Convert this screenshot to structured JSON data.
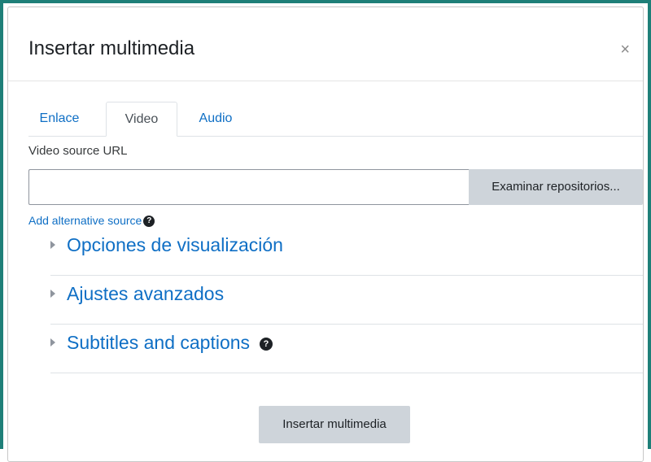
{
  "dialog": {
    "title": "Insertar multimedia",
    "close_label": "×"
  },
  "tabs": [
    {
      "label": "Enlace",
      "active": false
    },
    {
      "label": "Video",
      "active": true
    },
    {
      "label": "Audio",
      "active": false
    }
  ],
  "video": {
    "source_label": "Video source URL",
    "url_value": "",
    "browse_label": "Examinar repositorios...",
    "alt_source_label": "Add alternative source"
  },
  "sections": [
    {
      "title": "Opciones de visualización",
      "has_help": false
    },
    {
      "title": "Ajustes avanzados",
      "has_help": false
    },
    {
      "title": "Subtitles and captions",
      "has_help": true
    }
  ],
  "footer": {
    "insert_label": "Insertar multimedia"
  },
  "colors": {
    "frame": "#1e7f78",
    "link": "#0f6fc5",
    "button": "#ced4da"
  },
  "icons": {
    "help": "?"
  }
}
